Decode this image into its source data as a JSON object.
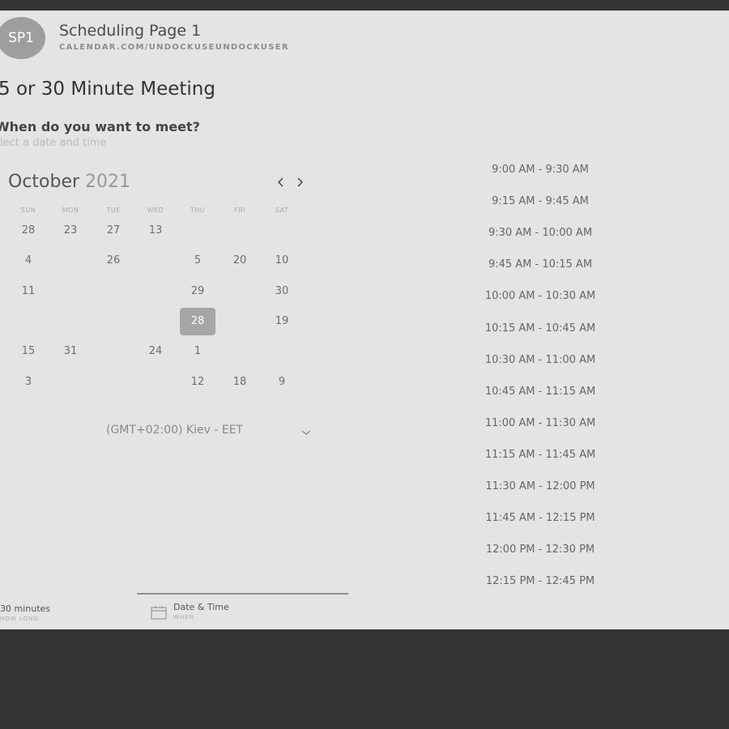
{
  "header": {
    "avatar_text": "SP1",
    "title": "Scheduling Page 1",
    "url": "CALENDAR.COM/UNDOCKUSEUNDOCKUSER"
  },
  "meeting": {
    "title": "5 or 30 Minute Meeting",
    "question": "When do you want to meet?",
    "hint": "elect a date and time"
  },
  "calendar": {
    "month": "October",
    "year": "2021",
    "weekdays": [
      "SUN",
      "MON",
      "TUE",
      "WED",
      "THU",
      "FRI",
      "SAT"
    ],
    "rows": [
      [
        "28",
        "23",
        "27",
        "13",
        "",
        "",
        ""
      ],
      [
        "4",
        "",
        "26",
        "",
        "5",
        "20",
        "10"
      ],
      [
        "11",
        "",
        "",
        "",
        "29",
        "",
        "30"
      ],
      [
        "",
        "",
        "",
        "",
        "28",
        "",
        "19"
      ],
      [
        "15",
        "31",
        "",
        "24",
        "1",
        "",
        ""
      ],
      [
        "3",
        "",
        "",
        "",
        "12",
        "18",
        "9"
      ]
    ],
    "selected_day": "28",
    "prev_icon": "chevron-left",
    "next_icon": "chevron-right"
  },
  "timezone": {
    "label": "(GMT+02:00) Kiev - EET",
    "icon": "chevron-down"
  },
  "time_slots": [
    "9:00 AM - 9:30 AM",
    "9:15 AM - 9:45 AM",
    "9:30 AM - 10:00 AM",
    "9:45 AM - 10:15 AM",
    "10:00 AM - 10:30 AM",
    "10:15 AM - 10:45 AM",
    "10:30 AM - 11:00 AM",
    "10:45 AM - 11:15 AM",
    "11:00 AM - 11:30 AM",
    "11:15 AM - 11:45 AM",
    "11:30 AM - 12:00 PM",
    "11:45 AM - 12:15 PM",
    "12:00 PM - 12:30 PM",
    "12:15 PM - 12:45 PM"
  ],
  "footer": {
    "duration": "30 minutes",
    "duration_sub": "HOW LONG",
    "datetime_label": "Date & Time",
    "datetime_sub": "WHEN",
    "datetime_icon": "calendar"
  },
  "colors": {
    "frame": "#333333",
    "panel": "#e4e4e4",
    "selected_day": "#a6a6a6",
    "avatar": "#9e9e9e"
  }
}
